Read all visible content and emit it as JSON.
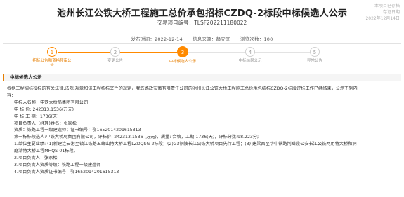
{
  "header": {
    "title": "池州长江公铁大桥工程施工总价承包招标CZDQ-2标段中标候选人公示",
    "code_label": "交易项目编号：",
    "code_value": "TLSF202211180022",
    "stamp_lines": [
      "本项目已存档",
      "存证日期",
      "2022年12月14日"
    ]
  },
  "meta": {
    "publish_time": "发布时间：2022-12-14",
    "source": "信息来源：静安区",
    "views": "浏览次数：100"
  },
  "steps": [
    {
      "num": "1",
      "label_lines": [
        "招标公告和资格预审公",
        "告"
      ],
      "state": "done"
    },
    {
      "num": "2",
      "label_lines": [
        "变更公告"
      ],
      "state": "todo"
    },
    {
      "num": "3",
      "label_lines": [
        "中标候选人公示"
      ],
      "state": "active"
    },
    {
      "num": "4",
      "label_lines": [
        "中标结果公示"
      ],
      "state": "todo"
    },
    {
      "num": "5",
      "label_lines": [
        "异常公告"
      ],
      "state": "todo"
    }
  ],
  "section": {
    "title": "中标候选人公示"
  },
  "content": {
    "intro": "根据工程招标投标的有关法律,法规,规章和该工程招标文件的规定，我铁路政安徽有限责任公司的池州长江公铁大桥工程施工总价承包招标CZDQ-2标段评标工作已经结束，公示下列内",
    "intro2": "容：",
    "winner": "中标人名称：中铁大桥局集团有限公司",
    "price": "中 标 价: 242313.1536(万元)",
    "period": "中 标 工 期：1736(天)",
    "pm": "项目负责人（经理)姓名：张家松",
    "qual": "资质：铁路工程一级建造师；证书编号：鄂1652014201615313",
    "first": "第一标标候选人:中铁大桥局集团有限公司，评标价: 242313.1536 (万元)，质量: 合格，工期:1736(天)，评标分数:98.223分;",
    "perf": "1.单位主要业绩: (1)新建连云港至镇江铁路五峰山特大桥工程LZDQSG-2标段；(2)G3铜陵长江公铁大桥项目先行工程；(3) 建梁西至华中铁路荆岳段公安长江公铁两用特大桥和洞",
    "perf2": "庭湖特大桥工程MHQS-01标段。",
    "pm2": "2.项目负责人：张家松",
    "pmqual": "3.项目负责人资质等级：铁路工程一级建造师",
    "pmcert": "4.项目负责人资质证书编号：鄂1652014201615313"
  }
}
